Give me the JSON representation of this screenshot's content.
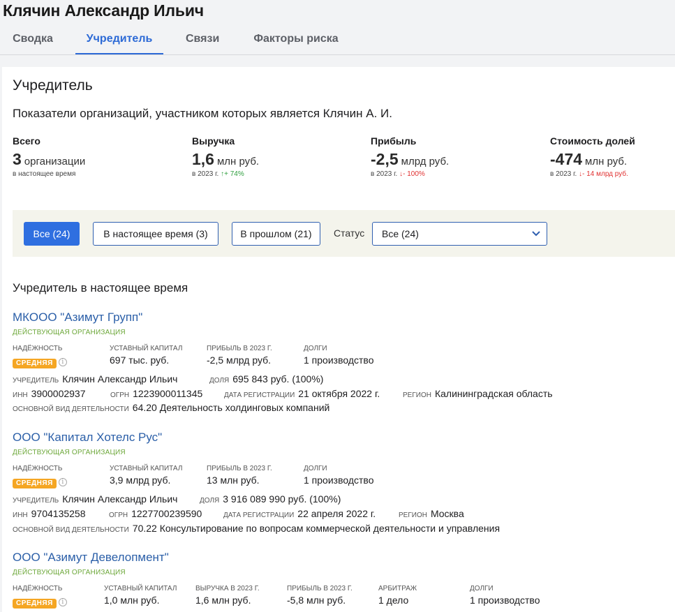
{
  "person": {
    "name": "Клячин Александр Ильич"
  },
  "tabs": [
    {
      "label": "Сводка",
      "active": false
    },
    {
      "label": "Учредитель",
      "active": true
    },
    {
      "label": "Связи",
      "active": false
    },
    {
      "label": "Факторы риска",
      "active": false
    }
  ],
  "page": {
    "title": "Учредитель",
    "subtitle": "Показатели организаций, участником которых является Клячин А. И."
  },
  "stats": [
    {
      "label": "Всего",
      "value": "3",
      "unit": "организации",
      "note": "в настоящее время",
      "change": "",
      "trend": ""
    },
    {
      "label": "Выручка",
      "value": "1,6",
      "unit": "млн руб.",
      "note": "в 2023 г.",
      "change": "+ 74%",
      "trend": "up"
    },
    {
      "label": "Прибыль",
      "value": "-2,5",
      "unit": "млрд руб.",
      "note": "в 2023 г.",
      "change": "- 100%",
      "trend": "down"
    },
    {
      "label": "Стоимость долей",
      "value": "-474",
      "unit": "млн руб.",
      "note": "в 2023 г.",
      "change": "- 14 млрд руб.",
      "trend": "down"
    }
  ],
  "filters": {
    "buttons": [
      {
        "label": "Все (24)",
        "active": true
      },
      {
        "label": "В настоящее время (3)",
        "active": false
      },
      {
        "label": "В прошлом (21)",
        "active": false
      }
    ],
    "status_label": "Статус",
    "status_value": "Все (24)"
  },
  "section_title": "Учредитель в настоящее время",
  "labels": {
    "reliability": "НАДЁЖНОСТЬ",
    "capital": "УСТАВНЫЙ КАПИТАЛ",
    "profit": "ПРИБЫЛЬ В 2023 Г.",
    "revenue": "ВЫРУЧКА В 2023 Г.",
    "debts": "ДОЛГИ",
    "arbitration": "АРБИТРАЖ",
    "founder": "УЧРЕДИТЕЛЬ",
    "share": "ДОЛЯ",
    "inn": "ИНН",
    "ogrn": "ОГРН",
    "reg_date": "ДАТА РЕГИСТРАЦИИ",
    "region": "РЕГИОН",
    "activity": "ОСНОВНОЙ ВИД ДЕЯТЕЛЬНОСТИ"
  },
  "orgs": [
    {
      "name": "МКООО \"Азимут Групп\"",
      "status": "ДЕЙСТВУЮЩАЯ ОРГАНИЗАЦИЯ",
      "reliability": "СРЕДНЯЯ",
      "capital": "697 тыс. руб.",
      "profit": "-2,5 млрд руб.",
      "debts": "1 производство",
      "founder": "Клячин Александр Ильич",
      "share": "695 843 руб. (100%)",
      "inn": "3900002937",
      "ogrn": "1223900011345",
      "reg_date": "21 октября 2022 г.",
      "region": "Калининградская область",
      "activity": "64.20 Деятельность холдинговых компаний"
    },
    {
      "name": "ООО \"Капитал Хотелс Рус\"",
      "status": "ДЕЙСТВУЮЩАЯ ОРГАНИЗАЦИЯ",
      "reliability": "СРЕДНЯЯ",
      "capital": "3,9 млрд руб.",
      "profit": "13 млн руб.",
      "debts": "1 производство",
      "founder": "Клячин Александр Ильич",
      "share": "3 916 089 990 руб. (100%)",
      "inn": "9704135258",
      "ogrn": "1227700239590",
      "reg_date": "22 апреля 2022 г.",
      "region": "Москва",
      "activity": "70.22 Консультирование по вопросам коммерческой деятельности и управления"
    },
    {
      "name": "ООО \"Азимут Девелопмент\"",
      "status": "ДЕЙСТВУЮЩАЯ ОРГАНИЗАЦИЯ",
      "reliability": "СРЕДНЯЯ",
      "capital": "1,0 млн руб.",
      "revenue": "1,6 млн руб.",
      "profit": "-5,8 млн руб.",
      "arbitration": "1 дело",
      "debts": "1 производство"
    }
  ],
  "colors": {
    "accent": "#2f6fe0",
    "link": "#2b5fa8",
    "active_org": "#6da83a",
    "badge_medium": "#f5a623",
    "up": "#2e9e3e",
    "down": "#e03131"
  }
}
